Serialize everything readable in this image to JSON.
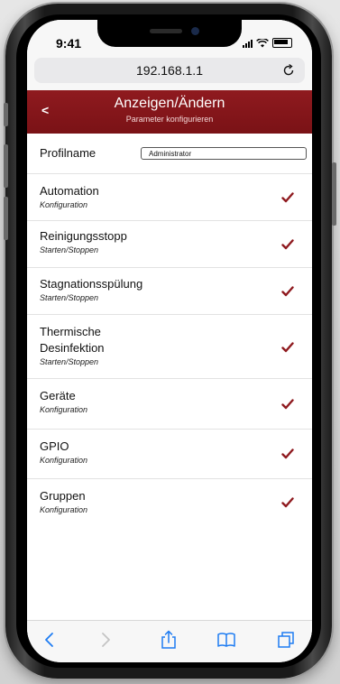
{
  "status_bar": {
    "time": "9:41"
  },
  "browser": {
    "url": "192.168.1.1"
  },
  "header": {
    "back_label": "<",
    "title": "Anzeigen/Ändern",
    "subtitle": "Parameter konfigurieren"
  },
  "profile": {
    "label": "Profilname",
    "value": "Administrator"
  },
  "items": [
    {
      "title": "Automation",
      "subtitle": "Konfiguration",
      "checked": true
    },
    {
      "title": "Reinigungsstopp",
      "subtitle": "Starten/Stoppen",
      "checked": true
    },
    {
      "title": "Stagnationsspülung",
      "subtitle": "Starten/Stoppen",
      "checked": true
    },
    {
      "title_line1": "Thermische",
      "title_line2": "Desinfektion",
      "subtitle": "Starten/Stoppen",
      "checked": true
    },
    {
      "title": "Geräte",
      "subtitle": "Konfiguration",
      "checked": true
    },
    {
      "title": "GPIO",
      "subtitle": "Konfiguration",
      "checked": true
    },
    {
      "title": "Gruppen",
      "subtitle": "Konfiguration",
      "checked": true
    }
  ],
  "colors": {
    "header": "#7a1216",
    "check": "#8f1a1f",
    "toolbar_icon": "#1e7cf2"
  },
  "icons": {
    "reload": "reload-icon",
    "back": "chevron-left-icon",
    "forward": "chevron-right-icon",
    "share": "share-icon",
    "bookmarks": "book-icon",
    "tabs": "tabs-icon",
    "check": "checkmark-icon"
  }
}
